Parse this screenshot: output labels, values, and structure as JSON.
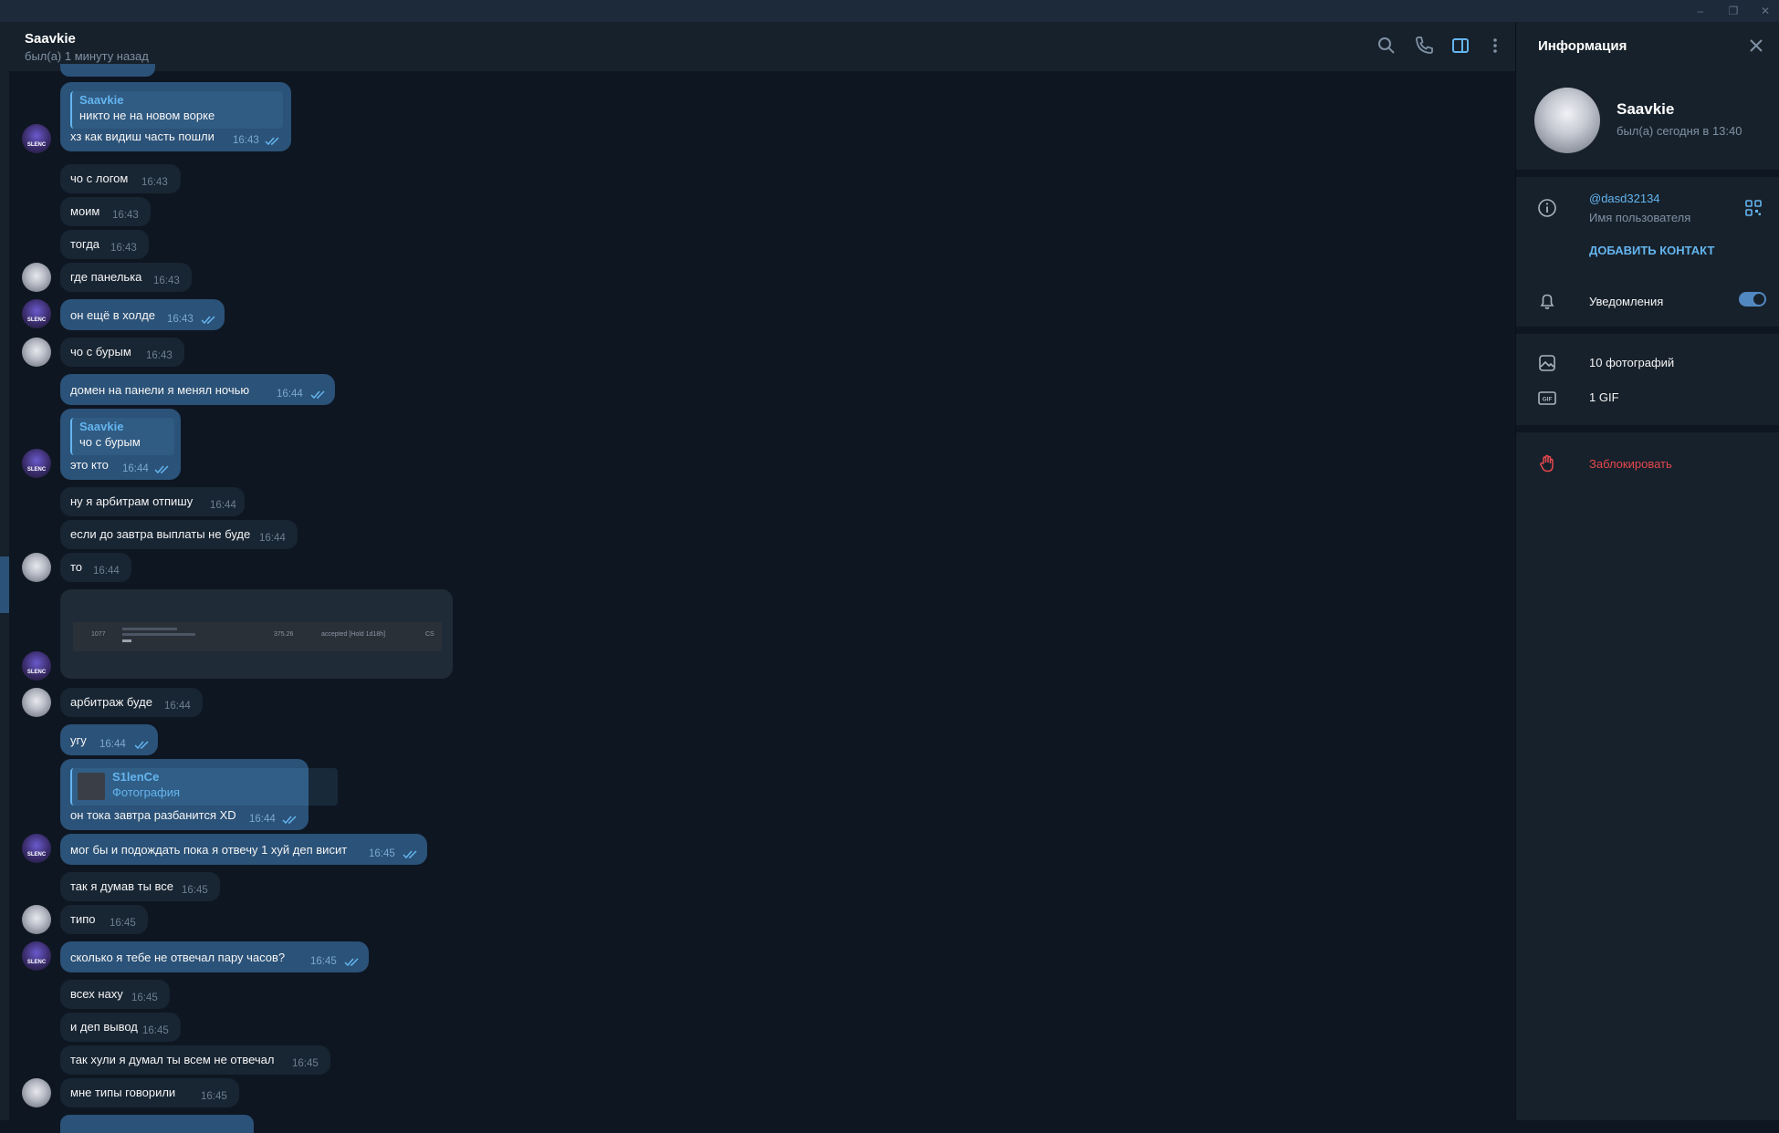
{
  "window": {
    "minimize": "–",
    "restore": "❐",
    "close": "✕"
  },
  "header": {
    "name": "Saavkie",
    "status": "был(а) 1 минуту назад",
    "icons": [
      "search-icon",
      "phone-icon",
      "sidebar-toggle-icon",
      "more-vertical-icon"
    ]
  },
  "colors": {
    "bg": "#0e1621",
    "panel": "#17212b",
    "incoming": "#182533",
    "outgoing": "#2b5278",
    "accent": "#64b5ef",
    "danger": "#e5484d"
  },
  "messages": [
    {
      "text": "хз как видиш часть пошли",
      "time": "16:43",
      "reply_name": "Saavkie",
      "reply_text": "никто не на новом ворке"
    },
    {
      "text": "чо с логом",
      "time": "16:43"
    },
    {
      "text": "моим",
      "time": "16:43"
    },
    {
      "text": "тогда",
      "time": "16:43"
    },
    {
      "text": "где панелька",
      "time": "16:43"
    },
    {
      "text": "он ещё в холде",
      "time": "16:43"
    },
    {
      "text": "чо с бурым",
      "time": "16:43"
    },
    {
      "text": "домен на панели я менял ночью",
      "time": "16:44"
    },
    {
      "text": "это кто",
      "time": "16:44",
      "reply_name": "Saavkie",
      "reply_text": "чо с бурым"
    },
    {
      "text": "ну я арбитрам отпишу",
      "time": "16:44"
    },
    {
      "text": "если до завтра выплаты не буде",
      "time": "16:44"
    },
    {
      "text": "то",
      "time": "16:44"
    },
    {
      "text": "арбитраж буде",
      "time": "16:44"
    },
    {
      "text": "угу",
      "time": "16:44"
    },
    {
      "text": "он тока завтра разбанится XD",
      "time": "16:44",
      "reply_name": "S1lenCe",
      "reply_text": "Фотография"
    },
    {
      "text": "мог бы и подождать пока я отвечу 1 хуй деп висит",
      "time": "16:45"
    },
    {
      "text": "так я думав ты все",
      "time": "16:45"
    },
    {
      "text": "типо",
      "time": "16:45"
    },
    {
      "text": "сколько я тебе не отвечал пару часов?",
      "time": "16:45"
    },
    {
      "text": "всех наху",
      "time": "16:45"
    },
    {
      "text": "и деп вывод",
      "time": "16:45"
    },
    {
      "text": "так хули я думал ты всем не отвечал",
      "time": "16:45"
    },
    {
      "text": "мне типы говорили",
      "time": "16:45"
    }
  ],
  "image_message": {
    "row": {
      "id": "1077",
      "amount": "375.26",
      "status": "accepted [Hold 1d18h]",
      "flag": "CS"
    }
  },
  "panel": {
    "title": "Информация",
    "name": "Saavkie",
    "status": "был(а) сегодня в 13:40",
    "username": "@dasd32134",
    "username_label": "Имя пользователя",
    "add_contact": "ДОБАВИТЬ КОНТАКТ",
    "notifications": "Уведомления",
    "notifications_on": true,
    "photos": "10 фотографий",
    "gifs": "1 GIF",
    "block": "Заблокировать"
  }
}
